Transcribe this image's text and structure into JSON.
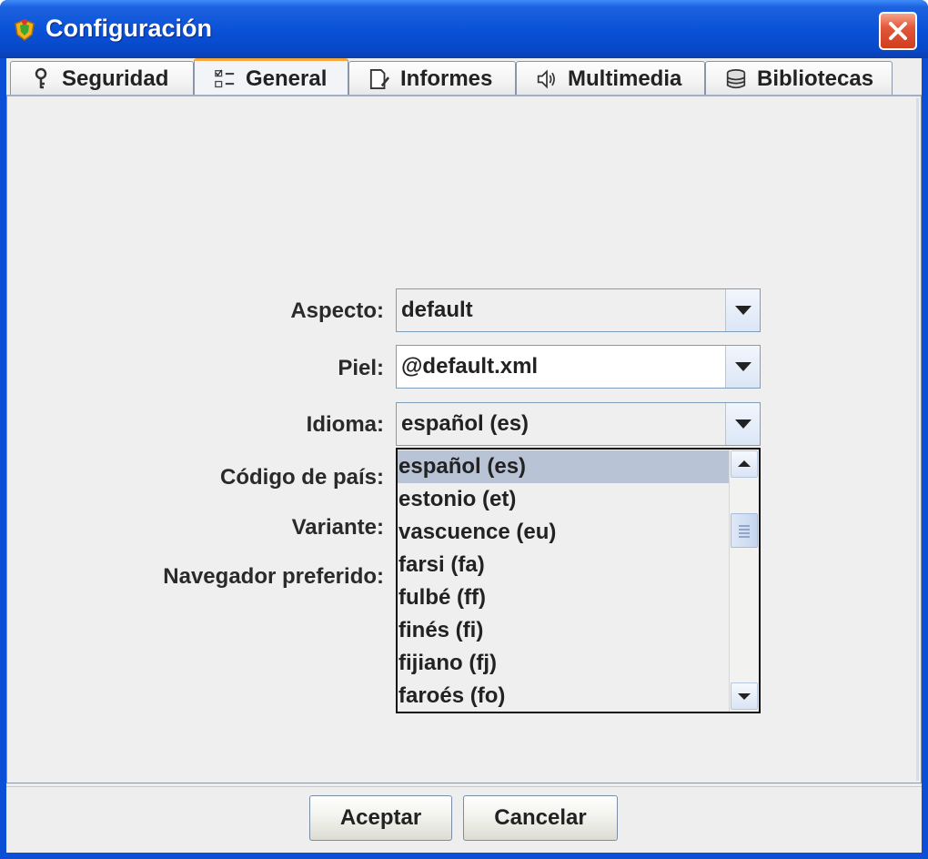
{
  "window": {
    "title": "Configuración",
    "close_label": "×"
  },
  "tabs": [
    {
      "label": "Seguridad",
      "icon": "key-icon",
      "selected": false
    },
    {
      "label": "General",
      "icon": "list-settings-icon",
      "selected": true
    },
    {
      "label": "Informes",
      "icon": "report-edit-icon",
      "selected": false
    },
    {
      "label": "Multimedia",
      "icon": "speaker-icon",
      "selected": false
    },
    {
      "label": "Bibliotecas",
      "icon": "database-icon",
      "selected": false
    }
  ],
  "form": {
    "aspecto": {
      "label": "Aspecto:",
      "value": "default"
    },
    "piel": {
      "label": "Piel:",
      "value": "@default.xml"
    },
    "idioma": {
      "label": "Idioma:",
      "value": "español (es)"
    },
    "codigo_pais": {
      "label": "Código de país:"
    },
    "variante": {
      "label": "Variante:"
    },
    "navegador": {
      "label": "Navegador preferido:"
    }
  },
  "idioma_dropdown": {
    "options": [
      "español (es)",
      "estonio (et)",
      "vascuence (eu)",
      "farsi (fa)",
      "fulbé (ff)",
      "finés (fi)",
      "fijiano (fj)",
      "faroés (fo)"
    ],
    "selected_index": 0
  },
  "buttons": {
    "ok": "Aceptar",
    "cancel": "Cancelar"
  },
  "colors": {
    "titlebar": "#0a52d8",
    "selected_tab_accent": "#f7a83a",
    "list_selection": "#b8c4d6"
  }
}
